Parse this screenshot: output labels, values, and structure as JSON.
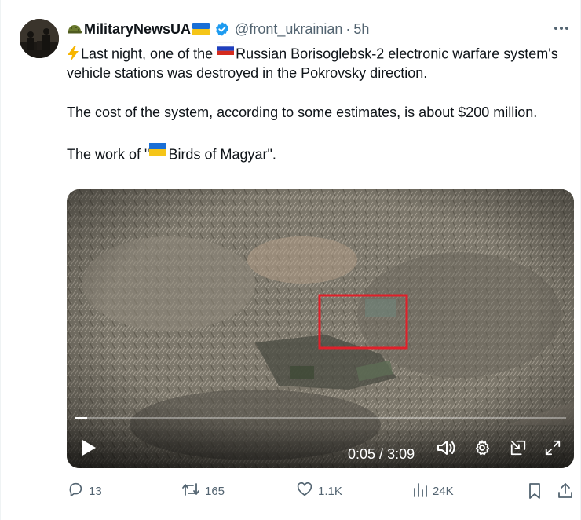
{
  "tweet": {
    "author": {
      "display_name": "MilitaryNewsUA",
      "handle": "@front_ukrainian",
      "separator": "·",
      "time_ago": "5h",
      "verified": true
    },
    "text": {
      "line1_pre": "Last night, one of the ",
      "line1_post": "Russian Borisoglebsk-2 electronic warfare system's vehicle stations was destroyed in the Pokrovsky direction.",
      "para2": "The cost of the system, according to some estimates, is about $200 million.",
      "para3_pre": "The work of \"",
      "para3_post": "Birds of Magyar\"."
    },
    "video": {
      "current_time": "0:05",
      "separator": " / ",
      "duration": "3:09",
      "progress_fraction": 0.026
    },
    "actions": {
      "replies": "13",
      "reposts": "165",
      "likes": "1.1K",
      "views": "24K"
    }
  },
  "icons": {
    "header": [
      "helmet-emoji",
      "ukraine-flag-emoji",
      "verified-badge-icon",
      "more-icon"
    ],
    "body": [
      "lightning-emoji",
      "russia-flag-emoji",
      "ukraine-flag-emoji"
    ],
    "video": [
      "play-icon",
      "volume-icon",
      "settings-icon",
      "picture-in-picture-icon",
      "fullscreen-icon"
    ],
    "actions": [
      "reply-icon",
      "repost-icon",
      "like-icon",
      "views-icon",
      "bookmark-icon",
      "share-icon"
    ]
  },
  "colors": {
    "text": "#0f1419",
    "secondary": "#536471",
    "verified": "#1d9bf0",
    "highlight_box": "#e0202a"
  }
}
